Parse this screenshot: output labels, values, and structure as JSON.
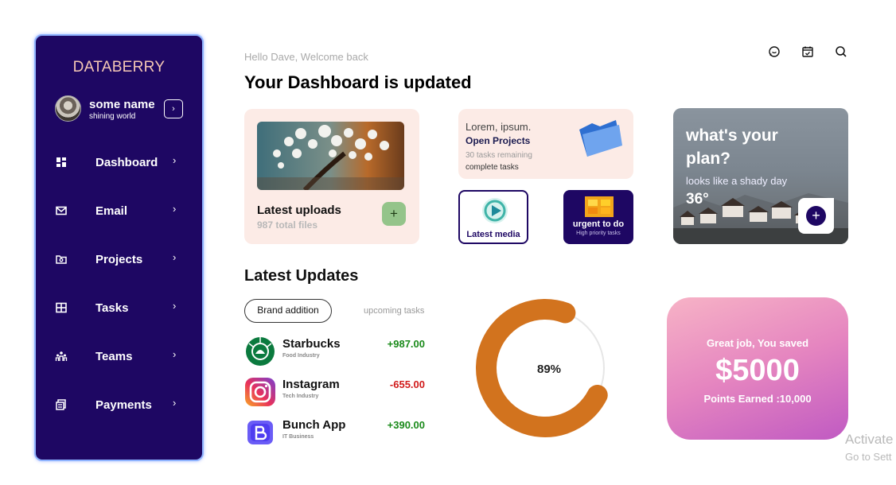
{
  "sidebar": {
    "brand": "DATABERRY",
    "profile": {
      "name": "some name",
      "subtitle": "shining world",
      "button": "›"
    },
    "items": [
      {
        "label": "Dashboard",
        "icon": "dashboard-icon"
      },
      {
        "label": "Email",
        "icon": "mail-icon"
      },
      {
        "label": "Projects",
        "icon": "folder-icon"
      },
      {
        "label": "Tasks",
        "icon": "tasks-grid-icon"
      },
      {
        "label": "Teams",
        "icon": "team-icon"
      },
      {
        "label": "Payments",
        "icon": "payments-icon"
      }
    ],
    "chevron": "›"
  },
  "header": {
    "greeting": "Hello Dave, Welcome back",
    "title": "Your Dashboard is updated",
    "icons": [
      "chat-icon",
      "calendar-icon",
      "search-icon"
    ]
  },
  "upload_card": {
    "title": "Latest uploads",
    "subtitle": "987 total files",
    "button": "+"
  },
  "projects_card": {
    "lorem": "Lorem, ipsum.",
    "title": "Open Projects",
    "remaining": "30 tasks remaining",
    "complete": "complete tasks"
  },
  "media_tile": {
    "label": "Latest media"
  },
  "urgent_tile": {
    "label": "urgent to do",
    "sub": "High priority tasks"
  },
  "weather_card": {
    "question": "what's your plan?",
    "subtitle": "looks like a shady day",
    "temp": "36°",
    "button": "+"
  },
  "updates": {
    "title": "Latest Updates",
    "chip_active": "Brand addition",
    "chip_other": "upcoming tasks",
    "transactions": [
      {
        "name": "Starbucks",
        "category": "Food Industry",
        "amount": "+987.00",
        "color": "#1a8a1a"
      },
      {
        "name": "Instagram",
        "category": "Tech Industry",
        "amount": "-655.00",
        "color": "#d11a1a"
      },
      {
        "name": "Bunch App",
        "category": "IT Business",
        "amount": "+390.00",
        "color": "#1a8a1a"
      }
    ]
  },
  "progress": {
    "label": "89%",
    "value": 0.89,
    "color": "#d2731e"
  },
  "savings_card": {
    "line1": "Great job, You saved",
    "amount": "$5000",
    "line3": "Points Earned :10,000"
  },
  "watermark": {
    "line1": "Activate",
    "line2": "Go to Sett"
  },
  "colors": {
    "sidebar": "#1e0763",
    "card": "#fcebe6",
    "accent": "#d2731e"
  }
}
